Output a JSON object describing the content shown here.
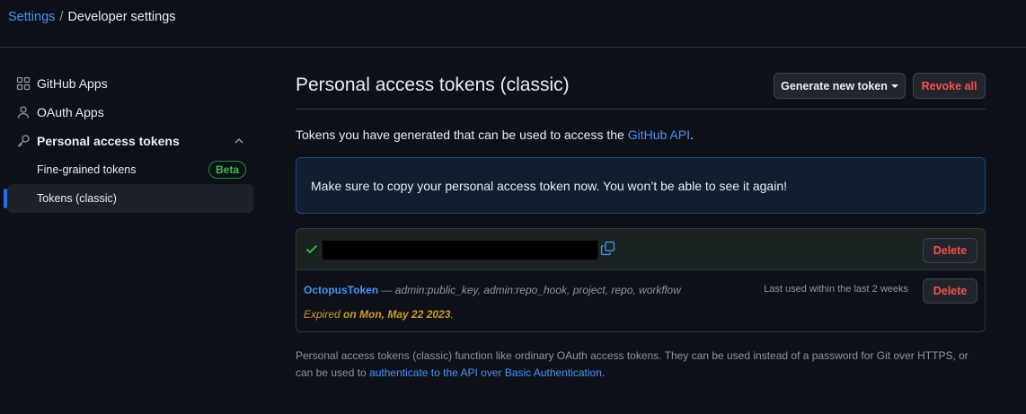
{
  "breadcrumb": {
    "root": "Settings",
    "separator": "/",
    "current": "Developer settings"
  },
  "sidebar": {
    "items": [
      {
        "label": "GitHub Apps",
        "icon": "apps-grid-icon"
      },
      {
        "label": "OAuth Apps",
        "icon": "person-icon"
      },
      {
        "label": "Personal access tokens",
        "icon": "key-icon",
        "expanded": true
      }
    ],
    "subitems": [
      {
        "label": "Fine-grained tokens",
        "badge": "Beta"
      },
      {
        "label": "Tokens (classic)",
        "active": true
      }
    ]
  },
  "main": {
    "title": "Personal access tokens (classic)",
    "generate_label": "Generate new token",
    "revoke_label": "Revoke all",
    "intro_text": "Tokens you have generated that can be used to access the ",
    "intro_link": "GitHub API",
    "intro_end": ".",
    "flash_text": "Make sure to copy your personal access token now. You won’t be able to see it again!",
    "new_token": {
      "value": "",
      "delete_label": "Delete"
    },
    "token": {
      "name": "OctopusToken",
      "scopes": " — admin:public_key, admin:repo_hook, project, repo, workflow",
      "last_used": "Last used within the last 2 weeks",
      "expired_prefix": "Expired",
      "expired_date": "on Mon, May 22 2023",
      "expired_suffix": ".",
      "delete_label": "Delete"
    },
    "footer_text": "Personal access tokens (classic) function like ordinary OAuth access tokens. They can be used instead of a password for Git over HTTPS, or can be used to ",
    "footer_link": "authenticate to the API over Basic Authentication",
    "footer_end": "."
  },
  "colors": {
    "background": "#0d1117",
    "accent": "#4493f8",
    "danger": "#f85149",
    "success": "#3fb950",
    "warning": "#d29922"
  }
}
